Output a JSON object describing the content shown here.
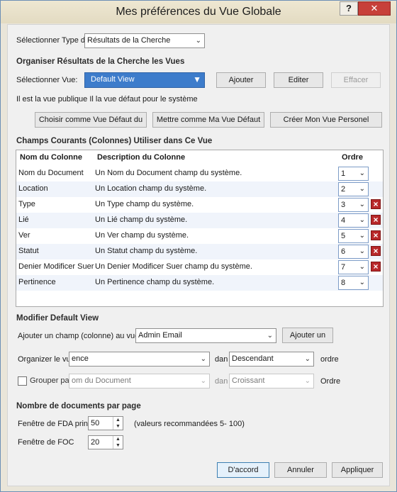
{
  "title": "Mes préférences du Vue Globale",
  "titlebar": {
    "help": "?",
    "close": "✕"
  },
  "select_type": {
    "label": "Sélectionner Type d",
    "value": "Résultats de la Cherche"
  },
  "organize": {
    "heading": "Organiser Résultats de la Cherche les Vues",
    "select_view_label": "Sélectionner Vue:",
    "select_view_value": "Default View",
    "add": "Ajouter",
    "edit": "Editer",
    "erase": "Effacer",
    "info": "Il est la vue publique Il la vue défaut pour le système",
    "choose_default": "Choisir comme Vue Défaut du",
    "set_my_default": "Mettre comme Ma Vue Défaut",
    "create_personal": "Créer Mon Vue Personel"
  },
  "columns": {
    "heading": "Champs Courants (Colonnes) Utiliser dans Ce Vue",
    "headers": {
      "name": "Nom du Colonne",
      "desc": "Description du Colonne",
      "order": "Ordre"
    },
    "rows": [
      {
        "name": "Nom du Document",
        "desc": "Un Nom du Document champ du système.",
        "order": "1",
        "deletable": false
      },
      {
        "name": "Location",
        "desc": "Un Location champ du système.",
        "order": "2",
        "deletable": false
      },
      {
        "name": "Type",
        "desc": "Un Type champ du système.",
        "order": "3",
        "deletable": true
      },
      {
        "name": "Lié",
        "desc": "Un Lié champ du système.",
        "order": "4",
        "deletable": true
      },
      {
        "name": "Ver",
        "desc": "Un Ver champ du système.",
        "order": "5",
        "deletable": true
      },
      {
        "name": "Statut",
        "desc": "Un Statut champ du système.",
        "order": "6",
        "deletable": true
      },
      {
        "name": "Denier Modificer Suer",
        "desc": "Un Denier Modificer Suer champ du système.",
        "order": "7",
        "deletable": true
      },
      {
        "name": "Pertinence",
        "desc": "Un Pertinence champ du système.",
        "order": "8",
        "deletable": false
      }
    ]
  },
  "modify": {
    "heading": "Modifier Default View",
    "add_field_label": "Ajouter un champ (colonne) au vue",
    "add_field_value": "Admin Email",
    "add_one": "Ajouter un",
    "organize_label": "Organizer le vue par",
    "organize_value": "ence",
    "dan1": "dan",
    "sort1_value": "Descendant",
    "ordre1": "ordre",
    "group_label": "Grouper par",
    "group_value": "om du Document",
    "dan2": "dan",
    "sort2_value": "Croissant",
    "ordre2": "Ordre"
  },
  "docs_per_page": {
    "heading": "Nombre de documents par page",
    "fda_label": "Fenêtre de FDA prin",
    "fda_value": "50",
    "fda_hint": "(valeurs recommandées 5- 100)",
    "foc_label": "Fenêtre de FOC",
    "foc_value": "20"
  },
  "footer": {
    "ok": "D'accord",
    "cancel": "Annuler",
    "apply": "Appliquer"
  },
  "icons": {
    "dropdown": "chevron-down-icon",
    "delete": "delete-x-icon"
  }
}
